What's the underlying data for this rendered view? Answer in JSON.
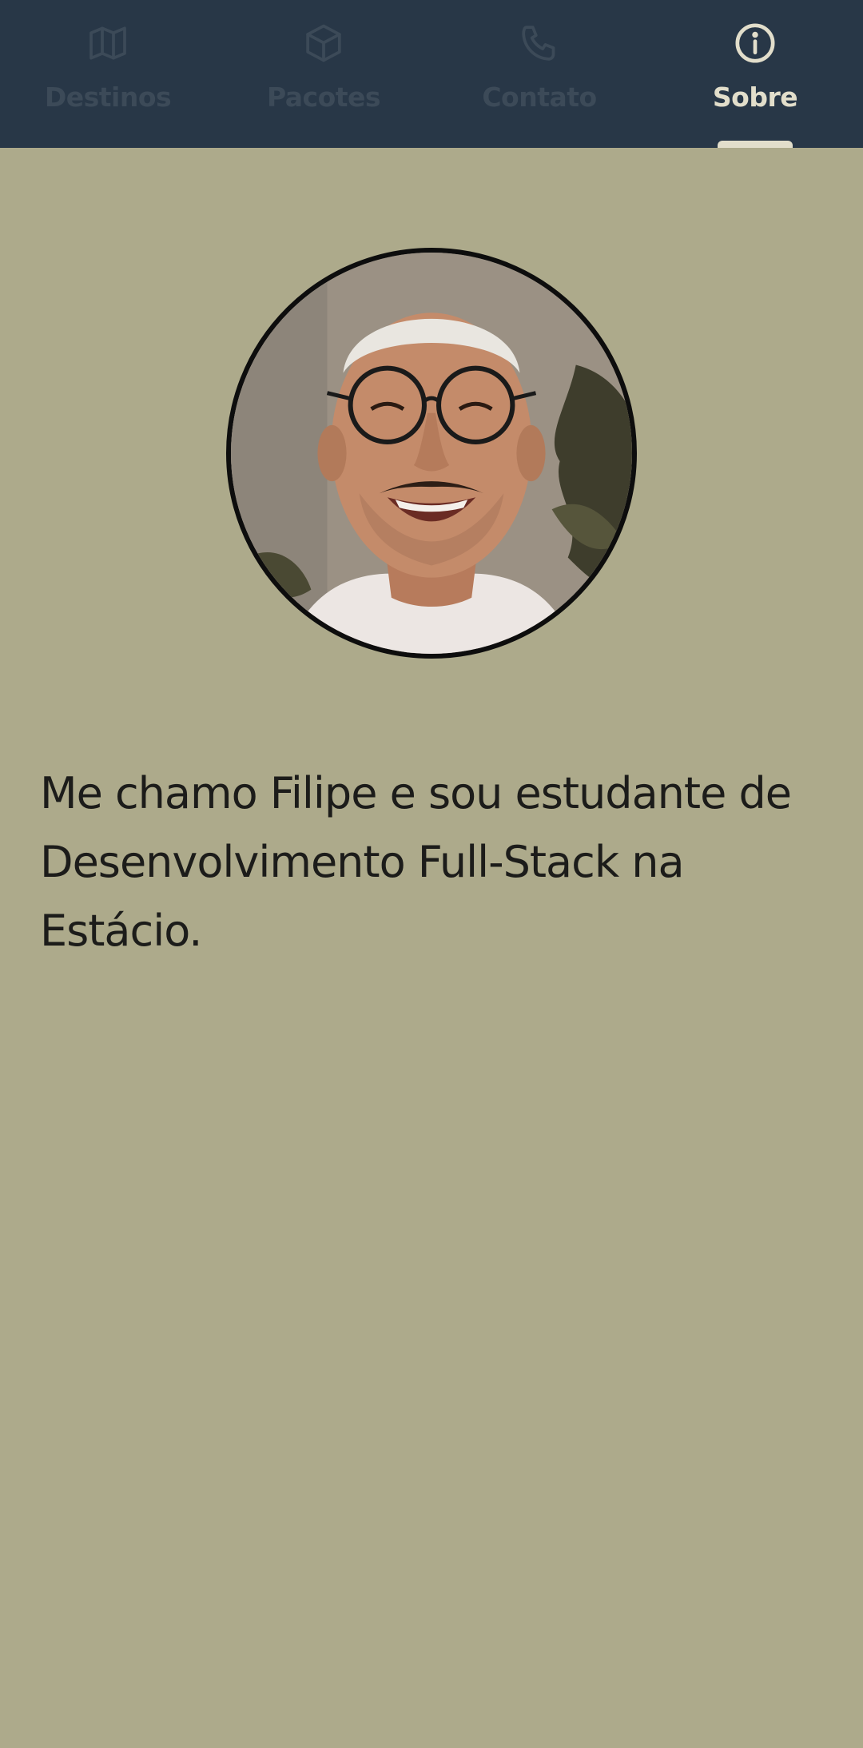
{
  "nav": {
    "tabs": [
      {
        "label": "Destinos",
        "icon": "map-icon",
        "active": false
      },
      {
        "label": "Pacotes",
        "icon": "package-icon",
        "active": false
      },
      {
        "label": "Contato",
        "icon": "phone-icon",
        "active": false
      },
      {
        "label": "Sobre",
        "icon": "info-icon",
        "active": true
      }
    ]
  },
  "about": {
    "bio": "Me chamo Filipe e sou estudante de Desenvolvimento Full-Stack na Estácio."
  },
  "colors": {
    "header_bg": "#283747",
    "page_bg": "#adaa8b",
    "active_tab": "#e2decb",
    "inactive_tab": "#3c4a58",
    "text": "#1c1c1a"
  }
}
